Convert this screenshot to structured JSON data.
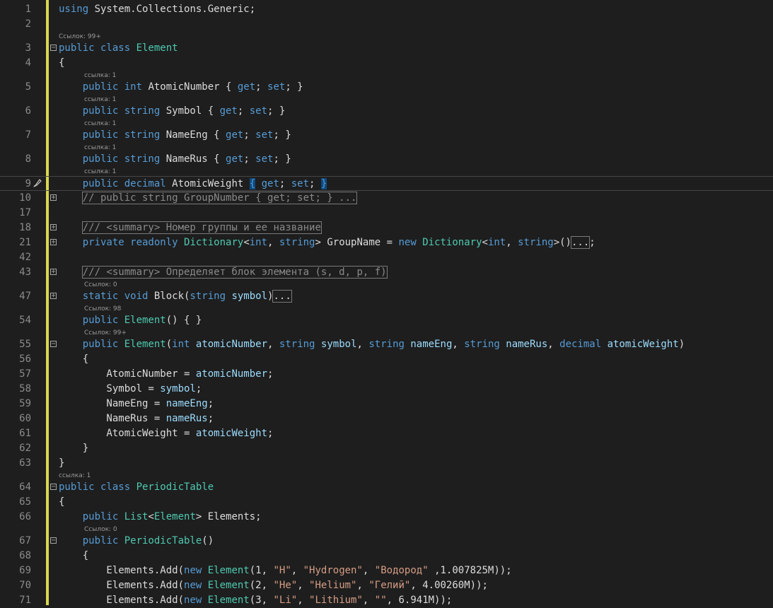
{
  "lines": [
    {
      "num": "1",
      "lens": null,
      "tokens": [
        [
          "kw",
          "using "
        ],
        [
          "tx",
          "System.Collections.Generic;"
        ]
      ]
    },
    {
      "num": "2",
      "lens": null,
      "tokens": []
    },
    {
      "num": "3",
      "lens": "Ссылок: 99+",
      "fold": "⊟",
      "tokens": [
        [
          "kw",
          "public class "
        ],
        [
          "ty",
          "Element"
        ]
      ]
    },
    {
      "num": "4",
      "lens": null,
      "tokens": [
        [
          "tx",
          "{"
        ]
      ]
    },
    {
      "num": "5",
      "lens": "ссылка: 1",
      "tokens": [
        [
          "kw",
          "    public int "
        ],
        [
          "tx",
          "AtomicNumber { "
        ],
        [
          "kw",
          "get"
        ],
        [
          "tx",
          "; "
        ],
        [
          "kw",
          "set"
        ],
        [
          "tx",
          "; }"
        ]
      ]
    },
    {
      "num": "6",
      "lens": "ссылка: 1",
      "tokens": [
        [
          "kw",
          "    public string "
        ],
        [
          "tx",
          "Symbol { "
        ],
        [
          "kw",
          "get"
        ],
        [
          "tx",
          "; "
        ],
        [
          "kw",
          "set"
        ],
        [
          "tx",
          "; }"
        ]
      ]
    },
    {
      "num": "7",
      "lens": "ссылка: 1",
      "tokens": [
        [
          "kw",
          "    public string "
        ],
        [
          "tx",
          "NameEng { "
        ],
        [
          "kw",
          "get"
        ],
        [
          "tx",
          "; "
        ],
        [
          "kw",
          "set"
        ],
        [
          "tx",
          "; }"
        ]
      ]
    },
    {
      "num": "8",
      "lens": "ссылка: 1",
      "tokens": [
        [
          "kw",
          "    public string "
        ],
        [
          "tx",
          "NameRus { "
        ],
        [
          "kw",
          "get"
        ],
        [
          "tx",
          "; "
        ],
        [
          "kw",
          "set"
        ],
        [
          "tx",
          "; }"
        ]
      ]
    },
    {
      "num": "9",
      "lens": "ссылка: 1",
      "current": true,
      "tokens": [
        [
          "kw",
          "    public decimal "
        ],
        [
          "tx",
          "AtomicWeight "
        ],
        [
          "hb",
          "{"
        ],
        [
          "kw",
          " get"
        ],
        [
          "tx",
          "; "
        ],
        [
          "kw",
          "set"
        ],
        [
          "tx",
          "; "
        ],
        [
          "hb",
          "}"
        ]
      ]
    },
    {
      "num": "10",
      "lens": null,
      "fold": "⊞",
      "tokens": [
        [
          "tx",
          "    "
        ],
        [
          "cmbox",
          "// public string GroupNumber { get; set; } ..."
        ]
      ]
    },
    {
      "num": "17",
      "lens": null,
      "tokens": []
    },
    {
      "num": "18",
      "lens": null,
      "fold": "⊞",
      "tokens": [
        [
          "tx",
          "    "
        ],
        [
          "cmbox",
          "/// <summary> Номер группы и ее название"
        ]
      ]
    },
    {
      "num": "21",
      "lens": null,
      "fold": "⊞",
      "tokens": [
        [
          "kw",
          "    private readonly "
        ],
        [
          "ty",
          "Dictionary"
        ],
        [
          "tx",
          "<"
        ],
        [
          "kw",
          "int"
        ],
        [
          "tx",
          ", "
        ],
        [
          "kw",
          "string"
        ],
        [
          "tx",
          "> GroupName = "
        ],
        [
          "kw",
          "new "
        ],
        [
          "ty",
          "Dictionary"
        ],
        [
          "tx",
          "<"
        ],
        [
          "kw",
          "int"
        ],
        [
          "tx",
          ", "
        ],
        [
          "kw",
          "string"
        ],
        [
          "tx",
          ">()"
        ],
        [
          "box",
          "..."
        ],
        [
          "tx",
          ";"
        ]
      ]
    },
    {
      "num": "42",
      "lens": null,
      "tokens": []
    },
    {
      "num": "43",
      "lens": null,
      "fold": "⊞",
      "tokens": [
        [
          "tx",
          "    "
        ],
        [
          "cmbox",
          "/// <summary> Определяет блок элемента (s, d, p, f)"
        ]
      ]
    },
    {
      "num": "47",
      "lens": "Ссылок: 0",
      "fold": "⊞",
      "tokens": [
        [
          "kw",
          "    static void "
        ],
        [
          "tx",
          "Block("
        ],
        [
          "kw",
          "string "
        ],
        [
          "id",
          "symbol"
        ],
        [
          "tx",
          ")"
        ],
        [
          "box",
          "..."
        ]
      ]
    },
    {
      "num": "54",
      "lens": "Ссылок: 98",
      "tokens": [
        [
          "kw",
          "    public "
        ],
        [
          "ty",
          "Element"
        ],
        [
          "tx",
          "() { }"
        ]
      ]
    },
    {
      "num": "55",
      "lens": "Ссылок: 99+",
      "fold": "⊟",
      "tokens": [
        [
          "kw",
          "    public "
        ],
        [
          "ty",
          "Element"
        ],
        [
          "tx",
          "("
        ],
        [
          "kw",
          "int "
        ],
        [
          "id",
          "atomicNumber"
        ],
        [
          "tx",
          ", "
        ],
        [
          "kw",
          "string "
        ],
        [
          "id",
          "symbol"
        ],
        [
          "tx",
          ", "
        ],
        [
          "kw",
          "string "
        ],
        [
          "id",
          "nameEng"
        ],
        [
          "tx",
          ", "
        ],
        [
          "kw",
          "string "
        ],
        [
          "id",
          "nameRus"
        ],
        [
          "tx",
          ", "
        ],
        [
          "kw",
          "decimal "
        ],
        [
          "id",
          "atomicWeight"
        ],
        [
          "tx",
          ")"
        ]
      ]
    },
    {
      "num": "56",
      "lens": null,
      "tokens": [
        [
          "tx",
          "    {"
        ]
      ]
    },
    {
      "num": "57",
      "lens": null,
      "tokens": [
        [
          "tx",
          "        AtomicNumber = "
        ],
        [
          "id",
          "atomicNumber"
        ],
        [
          "tx",
          ";"
        ]
      ]
    },
    {
      "num": "58",
      "lens": null,
      "tokens": [
        [
          "tx",
          "        Symbol = "
        ],
        [
          "id",
          "symbol"
        ],
        [
          "tx",
          ";"
        ]
      ]
    },
    {
      "num": "59",
      "lens": null,
      "tokens": [
        [
          "tx",
          "        NameEng = "
        ],
        [
          "id",
          "nameEng"
        ],
        [
          "tx",
          ";"
        ]
      ]
    },
    {
      "num": "60",
      "lens": null,
      "tokens": [
        [
          "tx",
          "        NameRus = "
        ],
        [
          "id",
          "nameRus"
        ],
        [
          "tx",
          ";"
        ]
      ]
    },
    {
      "num": "61",
      "lens": null,
      "tokens": [
        [
          "tx",
          "        AtomicWeight = "
        ],
        [
          "id",
          "atomicWeight"
        ],
        [
          "tx",
          ";"
        ]
      ]
    },
    {
      "num": "62",
      "lens": null,
      "tokens": [
        [
          "tx",
          "    }"
        ]
      ]
    },
    {
      "num": "63",
      "lens": null,
      "tokens": [
        [
          "tx",
          "}"
        ]
      ]
    },
    {
      "num": "64",
      "lens": "ссылка: 1",
      "fold": "⊟",
      "tokens": [
        [
          "kw",
          "public class "
        ],
        [
          "ty",
          "PeriodicTable"
        ]
      ]
    },
    {
      "num": "65",
      "lens": null,
      "tokens": [
        [
          "tx",
          "{"
        ]
      ]
    },
    {
      "num": "66",
      "lens": null,
      "tokens": [
        [
          "kw",
          "    public "
        ],
        [
          "ty",
          "List"
        ],
        [
          "tx",
          "<"
        ],
        [
          "ty",
          "Element"
        ],
        [
          "tx",
          "> Elements;"
        ]
      ]
    },
    {
      "num": "67",
      "lens": "Ссылок: 0",
      "fold": "⊟",
      "tokens": [
        [
          "kw",
          "    public "
        ],
        [
          "ty",
          "PeriodicTable"
        ],
        [
          "tx",
          "()"
        ]
      ]
    },
    {
      "num": "68",
      "lens": null,
      "tokens": [
        [
          "tx",
          "    {"
        ]
      ]
    },
    {
      "num": "69",
      "lens": null,
      "tokens": [
        [
          "tx",
          "        Elements.Add("
        ],
        [
          "kw",
          "new "
        ],
        [
          "ty",
          "Element"
        ],
        [
          "tx",
          "(1, "
        ],
        [
          "st",
          "\"H\""
        ],
        [
          "tx",
          ", "
        ],
        [
          "st",
          "\"Hydrogen\""
        ],
        [
          "tx",
          ", "
        ],
        [
          "st",
          "\"Водород\""
        ],
        [
          "tx",
          " ,1.007825M));"
        ]
      ]
    },
    {
      "num": "70",
      "lens": null,
      "tokens": [
        [
          "tx",
          "        Elements.Add("
        ],
        [
          "kw",
          "new "
        ],
        [
          "ty",
          "Element"
        ],
        [
          "tx",
          "(2, "
        ],
        [
          "st",
          "\"He\""
        ],
        [
          "tx",
          ", "
        ],
        [
          "st",
          "\"Helium\""
        ],
        [
          "tx",
          ", "
        ],
        [
          "st",
          "\"Гелий\""
        ],
        [
          "tx",
          ", 4.00260M));"
        ]
      ]
    },
    {
      "num": "71",
      "lens": null,
      "tokens": [
        [
          "tx",
          "        Elements.Add("
        ],
        [
          "kw",
          "new "
        ],
        [
          "ty",
          "Element"
        ],
        [
          "tx",
          "(3, "
        ],
        [
          "st",
          "\"Li\""
        ],
        [
          "tx",
          ", "
        ],
        [
          "st",
          "\"Lithium\""
        ],
        [
          "tx",
          ", "
        ],
        [
          "st",
          "\"\""
        ],
        [
          "tx",
          ", 6.941M));"
        ]
      ]
    }
  ]
}
